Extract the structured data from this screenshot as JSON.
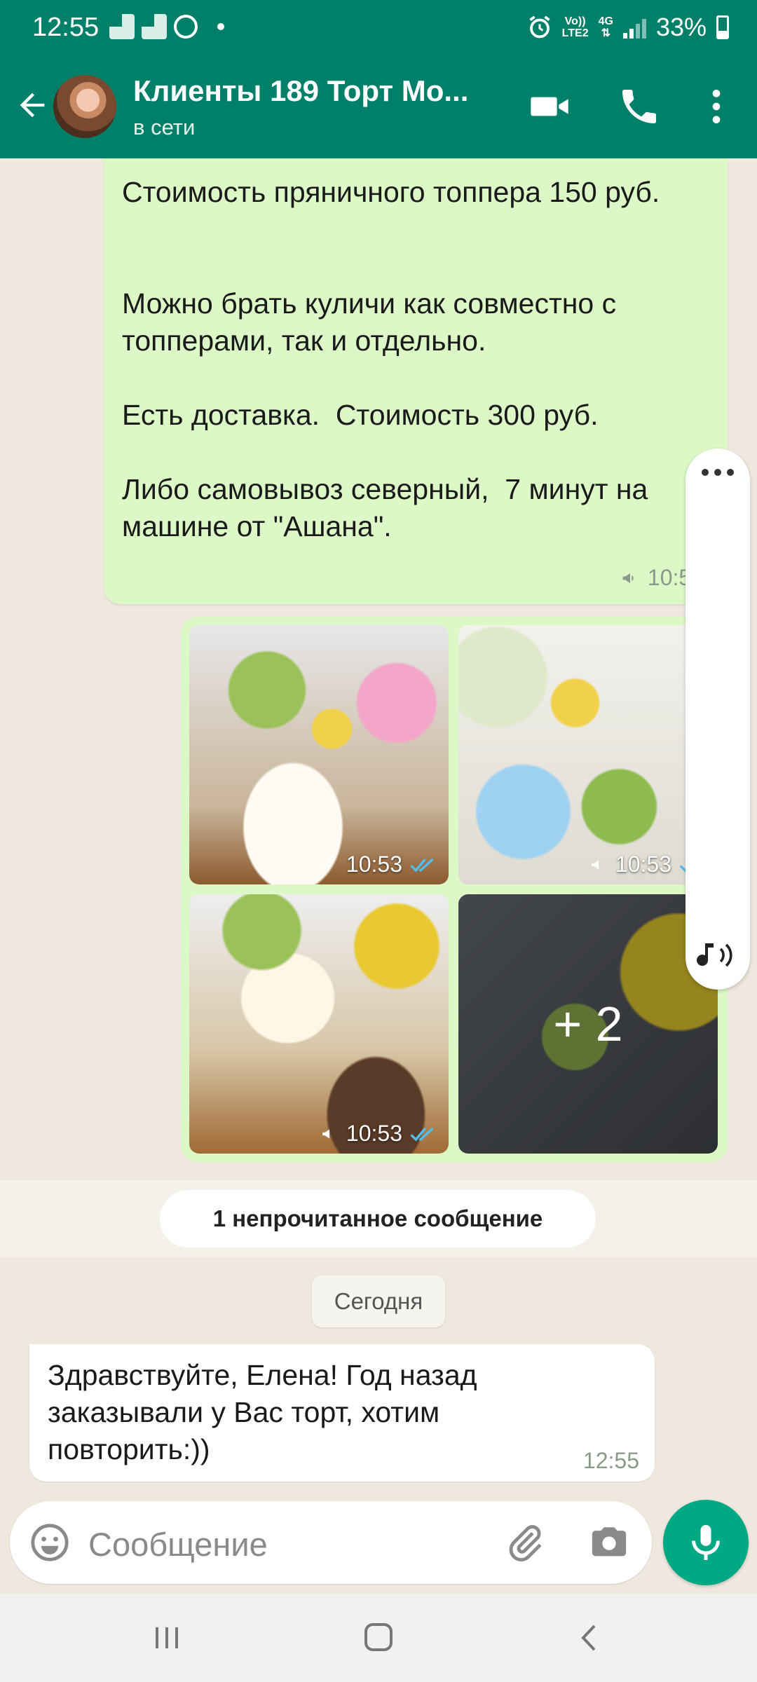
{
  "status_bar": {
    "time": "12:55",
    "network_top": "Vo))",
    "network_bottom": "LTE2",
    "net_type": "4G",
    "battery": "33%"
  },
  "header": {
    "title": "Клиенты 189 Торт Мо...",
    "status": "в сети"
  },
  "messages": [
    {
      "direction": "outgoing",
      "text": "Стоимость пряничного топпера 150 руб.\n\n\nМожно брать куличи как совместно с топперами, так и отдельно.\n\nЕсть доставка.  Стоимость 300 руб.\n\nЛибо самовывоз северный,  7 минут на машине от \"Ашана\".",
      "time": "10:53"
    }
  ],
  "media_group": {
    "items": [
      {
        "time": "10:53",
        "icon": "cupcake-bunny-photo"
      },
      {
        "time": "10:53",
        "icon": "easter-egg-cookies-photo"
      },
      {
        "time": "10:53",
        "icon": "kulich-tea-photo"
      }
    ],
    "more_count": "+ 2"
  },
  "unread_banner": "1 непрочитанное сообщение",
  "date_divider": "Сегодня",
  "incoming": {
    "text": "Здравствуйте, Елена! Год назад заказывали у Вас торт, хотим повторить:))",
    "time": "12:55"
  },
  "composer": {
    "placeholder": "Сообщение"
  },
  "colors": {
    "header": "#008069",
    "outgoing_bubble": "#dcf8c6",
    "accent": "#00a884",
    "read_ticks": "#53bdeb"
  }
}
